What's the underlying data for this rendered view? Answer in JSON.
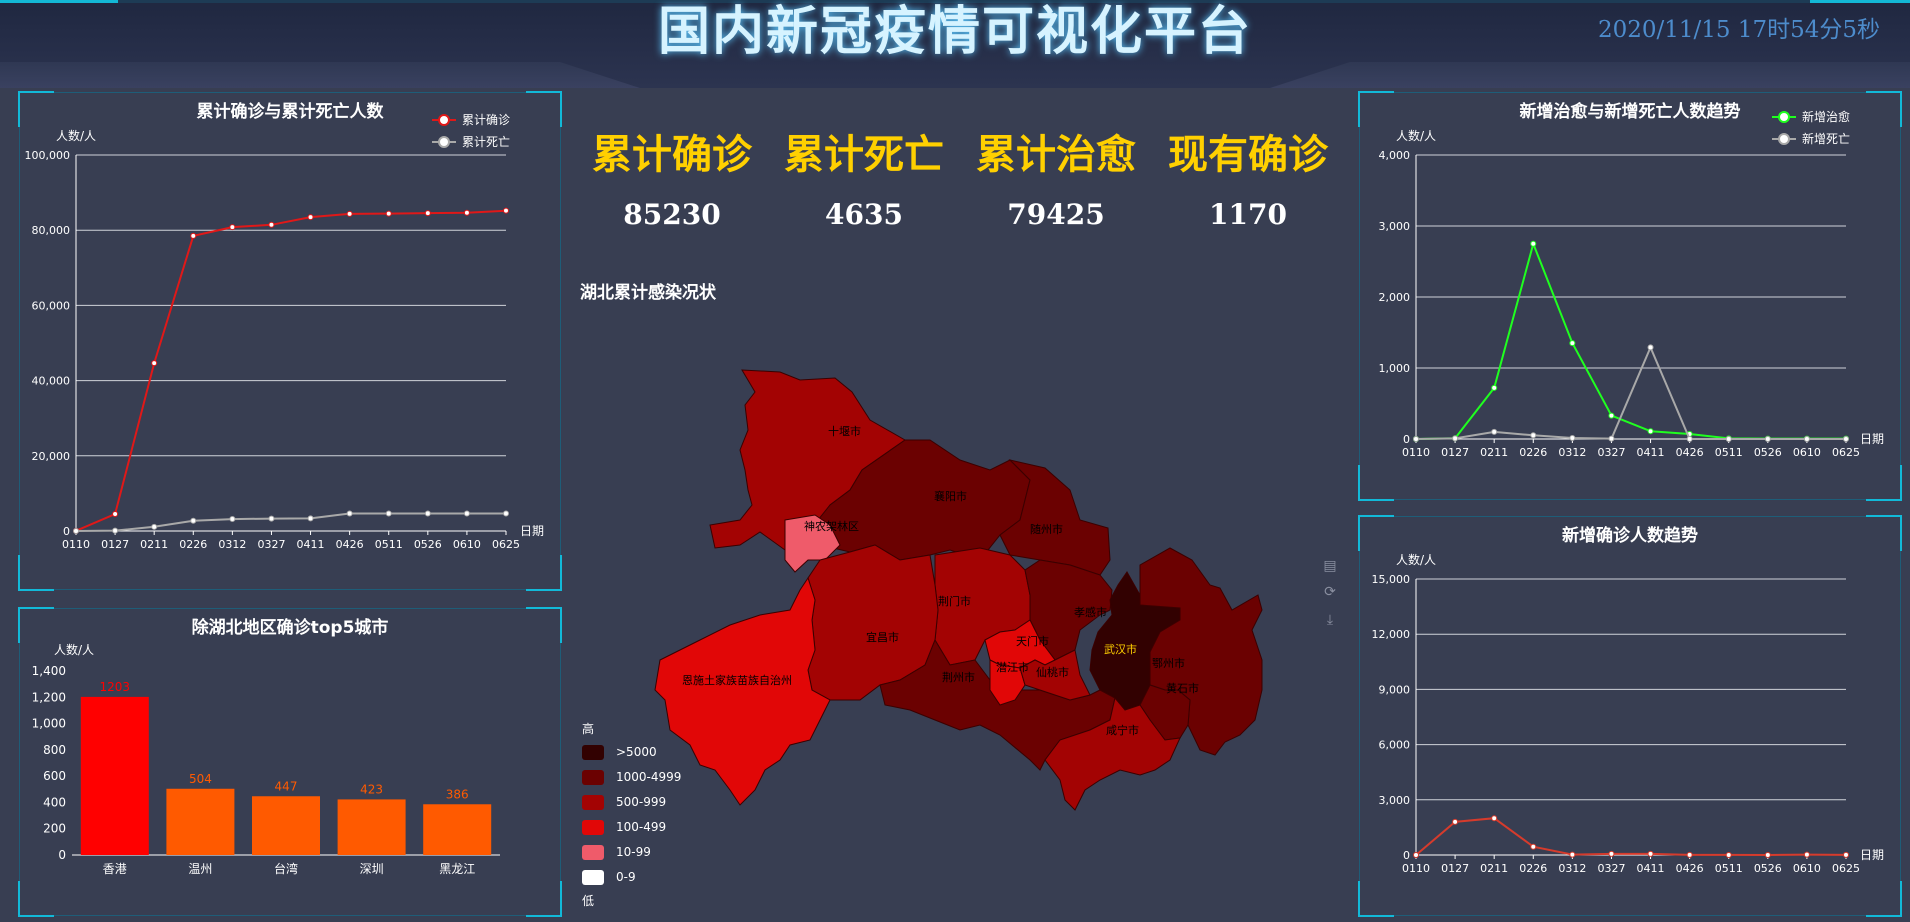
{
  "header": {
    "title": "国内新冠疫情可视化平台",
    "clock": "2020/11/15 17时54分5秒"
  },
  "colors": {
    "accent": "#12b9d8",
    "kpi": "#ffd000",
    "confirmed": "#e01818",
    "deaths": "#a9a9a9",
    "cured": "#1fff1f",
    "newConfirmed": "#d63b2c",
    "bar_top": "#ff0000",
    "bar": "#ff5a00"
  },
  "kpis": [
    {
      "label": "累计确诊",
      "value": "85230"
    },
    {
      "label": "累计死亡",
      "value": "4635"
    },
    {
      "label": "累计治愈",
      "value": "79425"
    },
    {
      "label": "现有确诊",
      "value": "1170"
    }
  ],
  "map": {
    "title": "湖北累计感染况状",
    "legend_high": "高",
    "legend_low": "低",
    "legend": [
      {
        "label": ">5000",
        "color": "#320101"
      },
      {
        "label": "1000-4999",
        "color": "#6b0101"
      },
      {
        "label": "500-999",
        "color": "#a30303"
      },
      {
        "label": "100-499",
        "color": "#e10707"
      },
      {
        "label": "10-99",
        "color": "#ef5b6a"
      },
      {
        "label": "0-9",
        "color": "#ffffff"
      }
    ],
    "cities": [
      "十堰市",
      "襄阳市",
      "随州市",
      "神农架林区",
      "荆门市",
      "孝感市",
      "宜昌市",
      "天门市",
      "武汉市",
      "鄂州市",
      "恩施土家族苗族自治州",
      "潜江市",
      "荆州市",
      "仙桃市",
      "黄石市",
      "咸宁市"
    ],
    "toolbox": [
      "data-view-icon",
      "restore-icon",
      "save-image-icon"
    ]
  },
  "chart_data": [
    {
      "id": "cumulative",
      "type": "line",
      "title": "累计确诊与累计死亡人数",
      "ylabel": "人数/人",
      "xlabel": "日期",
      "x": [
        "0110",
        "0127",
        "0211",
        "0226",
        "0312",
        "0327",
        "0411",
        "0426",
        "0511",
        "0526",
        "0610",
        "0625"
      ],
      "ylim": [
        0,
        100000
      ],
      "yticks": [
        "0",
        "20,000",
        "40,000",
        "60,000",
        "80,000",
        "100,000"
      ],
      "legend_position": "top-right",
      "series": [
        {
          "name": "累计确诊",
          "values": [
            41,
            4515,
            44653,
            78497,
            80815,
            81439,
            83482,
            84338,
            84416,
            84536,
            84652,
            85190
          ]
        },
        {
          "name": "累计死亡",
          "values": [
            1,
            106,
            1113,
            2717,
            3177,
            3300,
            3349,
            4642,
            4643,
            4645,
            4645,
            4648
          ]
        }
      ]
    },
    {
      "id": "top5",
      "type": "bar",
      "title": "除湖北地区确诊top5城市",
      "ylabel": "人数/人",
      "categories": [
        "香港",
        "温州",
        "台湾",
        "深圳",
        "黑龙江"
      ],
      "values": [
        1203,
        504,
        447,
        423,
        386
      ],
      "ylim": [
        0,
        1400
      ],
      "yticks": [
        "0",
        "200",
        "400",
        "600",
        "800",
        "1,000",
        "1,200",
        "1,400"
      ]
    },
    {
      "id": "cured_deaths",
      "type": "line",
      "title": "新增治愈与新增死亡人数趋势",
      "ylabel": "人数/人",
      "xlabel": "日期",
      "x": [
        "0110",
        "0127",
        "0211",
        "0226",
        "0312",
        "0327",
        "0411",
        "0426",
        "0511",
        "0526",
        "0610",
        "0625"
      ],
      "ylim": [
        0,
        4000
      ],
      "yticks": [
        "0",
        "1,000",
        "2,000",
        "3,000",
        "4,000"
      ],
      "legend_position": "top-right",
      "series": [
        {
          "name": "新增治愈",
          "values": [
            0,
            10,
            720,
            2750,
            1350,
            330,
            110,
            70,
            8,
            5,
            5,
            6
          ]
        },
        {
          "name": "新增死亡",
          "values": [
            0,
            8,
            100,
            52,
            14,
            5,
            1290,
            0,
            0,
            0,
            0,
            0
          ]
        }
      ]
    },
    {
      "id": "new_confirmed",
      "type": "line",
      "title": "新增确诊人数趋势",
      "ylabel": "人数/人",
      "xlabel": "日期",
      "x": [
        "0110",
        "0127",
        "0211",
        "0226",
        "0312",
        "0327",
        "0411",
        "0426",
        "0511",
        "0526",
        "0610",
        "0625"
      ],
      "ylim": [
        0,
        15000
      ],
      "yticks": [
        "0",
        "3,000",
        "6,000",
        "9,000",
        "12,000",
        "15,000"
      ],
      "series": [
        {
          "name": "新增确诊",
          "values": [
            0,
            1800,
            2000,
            450,
            20,
            60,
            60,
            5,
            3,
            2,
            20,
            5
          ]
        }
      ]
    }
  ]
}
